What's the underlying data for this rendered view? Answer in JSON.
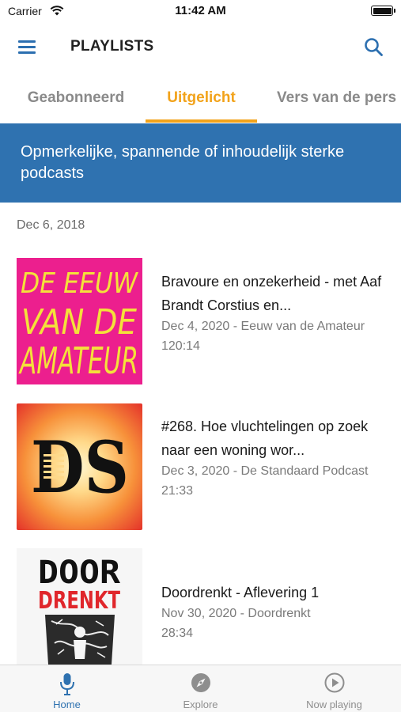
{
  "status_bar": {
    "carrier": "Carrier",
    "time": "11:42 AM"
  },
  "header": {
    "title": "PLAYLISTS"
  },
  "tabs": [
    {
      "label": "Geabonneerd",
      "active": false
    },
    {
      "label": "Uitgelicht",
      "active": true
    },
    {
      "label": "Vers van de pers",
      "active": false
    }
  ],
  "banner": {
    "text": "Opmerkelijke, spannende of inhoudelijk sterke podcasts"
  },
  "list": {
    "date_header": "Dec 6, 2018",
    "episodes": [
      {
        "title": "Bravoure en onzekerheid - met Aaf Brandt Corstius en...",
        "meta": "Dec 4, 2020 - Eeuw van de Amateur",
        "duration": "120:14",
        "cover_text": [
          "DE EEUW",
          "VAN DE",
          "AMATEUR"
        ]
      },
      {
        "title": "#268. Hoe vluchtelingen op zoek naar een woning wor...",
        "meta": "Dec 3, 2020 - De Standaard Podcast",
        "duration": "21:33",
        "cover_text": [
          "DS"
        ]
      },
      {
        "title": "Doordrenkt - Aflevering 1",
        "meta": "Nov 30, 2020 - Doordrenkt",
        "duration": "28:34",
        "cover_text": [
          "DOOR",
          "DRENKT"
        ]
      }
    ]
  },
  "tab_bar": {
    "items": [
      {
        "label": "Home",
        "icon": "microphone-icon",
        "active": true
      },
      {
        "label": "Explore",
        "icon": "compass-icon",
        "active": false
      },
      {
        "label": "Now playing",
        "icon": "play-circle-icon",
        "active": false
      }
    ]
  },
  "colors": {
    "accent": "#f2a31b",
    "brand_blue": "#2f72b0",
    "eeuw_pink": "#ec1f8e",
    "eeuw_text": "#f4e13a"
  }
}
